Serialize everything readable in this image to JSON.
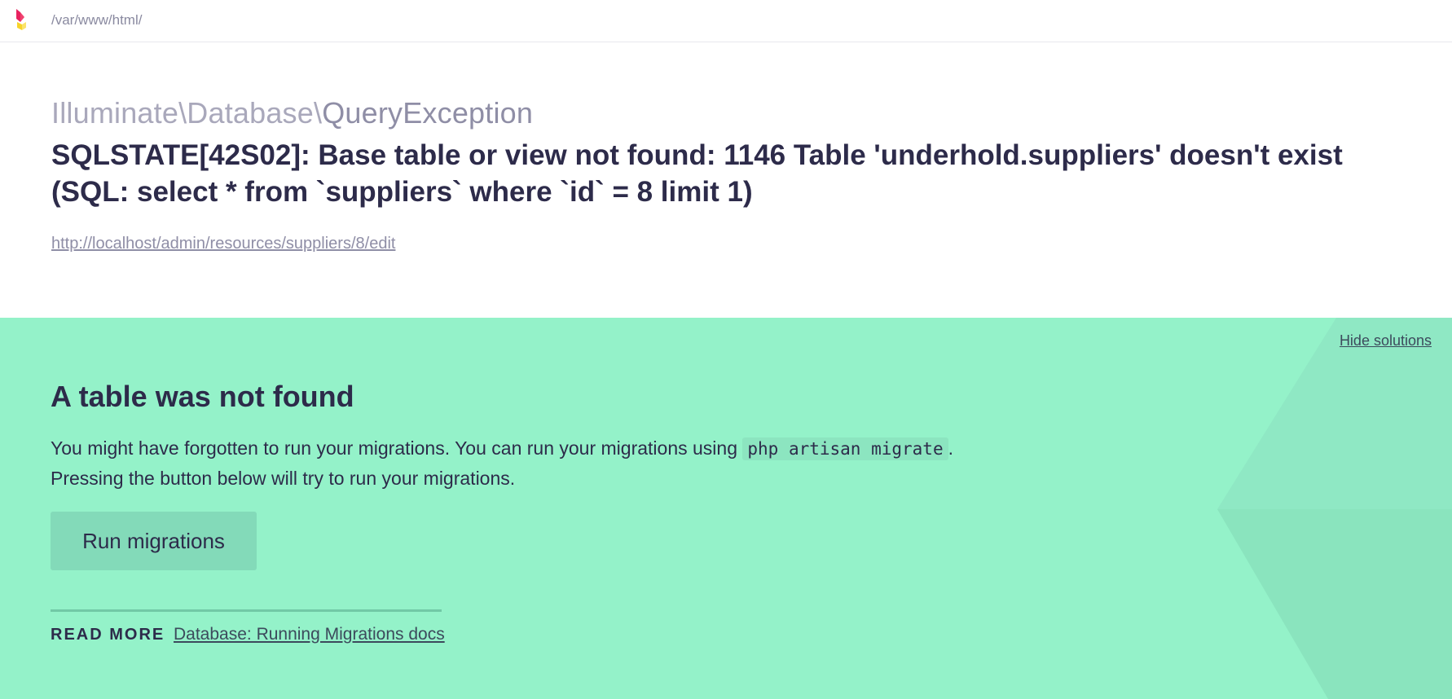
{
  "header": {
    "path": "/var/www/html/",
    "logo_icon": "ignition-logo-icon"
  },
  "exception": {
    "namespace": "Illuminate\\Database\\",
    "class_name": "QueryException",
    "message": "SQLSTATE[42S02]: Base table or view not found: 1146 Table 'underhold.suppliers' doesn't exist (SQL: select * from `suppliers` where `id` = 8 limit 1)",
    "url": "http://localhost/admin/resources/suppliers/8/edit"
  },
  "solution": {
    "hide_label": "Hide solutions",
    "title": "A table was not found",
    "description_before": "You might have forgotten to run your migrations. You can run your migrations using ",
    "command": "php artisan migrate",
    "description_after": ".",
    "description_line2": "Pressing the button below will try to run your migrations.",
    "button_label": "Run migrations",
    "read_more_label": "READ MORE",
    "read_more_link": "Database: Running Migrations docs"
  },
  "colors": {
    "solution_bg": "#94f2c9",
    "button_bg": "#83dab9",
    "text_dark": "#2d2b4a",
    "text_muted": "#a9a8bb"
  }
}
